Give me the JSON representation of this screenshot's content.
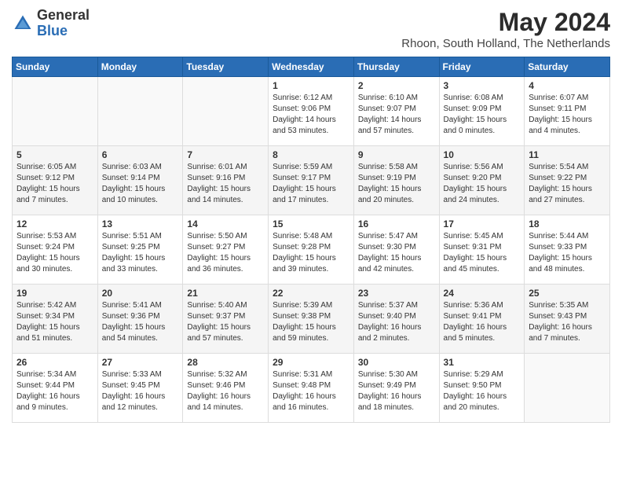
{
  "logo": {
    "general": "General",
    "blue": "Blue"
  },
  "title": {
    "month": "May 2024",
    "location": "Rhoon, South Holland, The Netherlands"
  },
  "weekdays": [
    "Sunday",
    "Monday",
    "Tuesday",
    "Wednesday",
    "Thursday",
    "Friday",
    "Saturday"
  ],
  "weeks": [
    [
      {
        "day": "",
        "info": ""
      },
      {
        "day": "",
        "info": ""
      },
      {
        "day": "",
        "info": ""
      },
      {
        "day": "1",
        "info": "Sunrise: 6:12 AM\nSunset: 9:06 PM\nDaylight: 14 hours and 53 minutes."
      },
      {
        "day": "2",
        "info": "Sunrise: 6:10 AM\nSunset: 9:07 PM\nDaylight: 14 hours and 57 minutes."
      },
      {
        "day": "3",
        "info": "Sunrise: 6:08 AM\nSunset: 9:09 PM\nDaylight: 15 hours and 0 minutes."
      },
      {
        "day": "4",
        "info": "Sunrise: 6:07 AM\nSunset: 9:11 PM\nDaylight: 15 hours and 4 minutes."
      }
    ],
    [
      {
        "day": "5",
        "info": "Sunrise: 6:05 AM\nSunset: 9:12 PM\nDaylight: 15 hours and 7 minutes."
      },
      {
        "day": "6",
        "info": "Sunrise: 6:03 AM\nSunset: 9:14 PM\nDaylight: 15 hours and 10 minutes."
      },
      {
        "day": "7",
        "info": "Sunrise: 6:01 AM\nSunset: 9:16 PM\nDaylight: 15 hours and 14 minutes."
      },
      {
        "day": "8",
        "info": "Sunrise: 5:59 AM\nSunset: 9:17 PM\nDaylight: 15 hours and 17 minutes."
      },
      {
        "day": "9",
        "info": "Sunrise: 5:58 AM\nSunset: 9:19 PM\nDaylight: 15 hours and 20 minutes."
      },
      {
        "day": "10",
        "info": "Sunrise: 5:56 AM\nSunset: 9:20 PM\nDaylight: 15 hours and 24 minutes."
      },
      {
        "day": "11",
        "info": "Sunrise: 5:54 AM\nSunset: 9:22 PM\nDaylight: 15 hours and 27 minutes."
      }
    ],
    [
      {
        "day": "12",
        "info": "Sunrise: 5:53 AM\nSunset: 9:24 PM\nDaylight: 15 hours and 30 minutes."
      },
      {
        "day": "13",
        "info": "Sunrise: 5:51 AM\nSunset: 9:25 PM\nDaylight: 15 hours and 33 minutes."
      },
      {
        "day": "14",
        "info": "Sunrise: 5:50 AM\nSunset: 9:27 PM\nDaylight: 15 hours and 36 minutes."
      },
      {
        "day": "15",
        "info": "Sunrise: 5:48 AM\nSunset: 9:28 PM\nDaylight: 15 hours and 39 minutes."
      },
      {
        "day": "16",
        "info": "Sunrise: 5:47 AM\nSunset: 9:30 PM\nDaylight: 15 hours and 42 minutes."
      },
      {
        "day": "17",
        "info": "Sunrise: 5:45 AM\nSunset: 9:31 PM\nDaylight: 15 hours and 45 minutes."
      },
      {
        "day": "18",
        "info": "Sunrise: 5:44 AM\nSunset: 9:33 PM\nDaylight: 15 hours and 48 minutes."
      }
    ],
    [
      {
        "day": "19",
        "info": "Sunrise: 5:42 AM\nSunset: 9:34 PM\nDaylight: 15 hours and 51 minutes."
      },
      {
        "day": "20",
        "info": "Sunrise: 5:41 AM\nSunset: 9:36 PM\nDaylight: 15 hours and 54 minutes."
      },
      {
        "day": "21",
        "info": "Sunrise: 5:40 AM\nSunset: 9:37 PM\nDaylight: 15 hours and 57 minutes."
      },
      {
        "day": "22",
        "info": "Sunrise: 5:39 AM\nSunset: 9:38 PM\nDaylight: 15 hours and 59 minutes."
      },
      {
        "day": "23",
        "info": "Sunrise: 5:37 AM\nSunset: 9:40 PM\nDaylight: 16 hours and 2 minutes."
      },
      {
        "day": "24",
        "info": "Sunrise: 5:36 AM\nSunset: 9:41 PM\nDaylight: 16 hours and 5 minutes."
      },
      {
        "day": "25",
        "info": "Sunrise: 5:35 AM\nSunset: 9:43 PM\nDaylight: 16 hours and 7 minutes."
      }
    ],
    [
      {
        "day": "26",
        "info": "Sunrise: 5:34 AM\nSunset: 9:44 PM\nDaylight: 16 hours and 9 minutes."
      },
      {
        "day": "27",
        "info": "Sunrise: 5:33 AM\nSunset: 9:45 PM\nDaylight: 16 hours and 12 minutes."
      },
      {
        "day": "28",
        "info": "Sunrise: 5:32 AM\nSunset: 9:46 PM\nDaylight: 16 hours and 14 minutes."
      },
      {
        "day": "29",
        "info": "Sunrise: 5:31 AM\nSunset: 9:48 PM\nDaylight: 16 hours and 16 minutes."
      },
      {
        "day": "30",
        "info": "Sunrise: 5:30 AM\nSunset: 9:49 PM\nDaylight: 16 hours and 18 minutes."
      },
      {
        "day": "31",
        "info": "Sunrise: 5:29 AM\nSunset: 9:50 PM\nDaylight: 16 hours and 20 minutes."
      },
      {
        "day": "",
        "info": ""
      }
    ]
  ]
}
